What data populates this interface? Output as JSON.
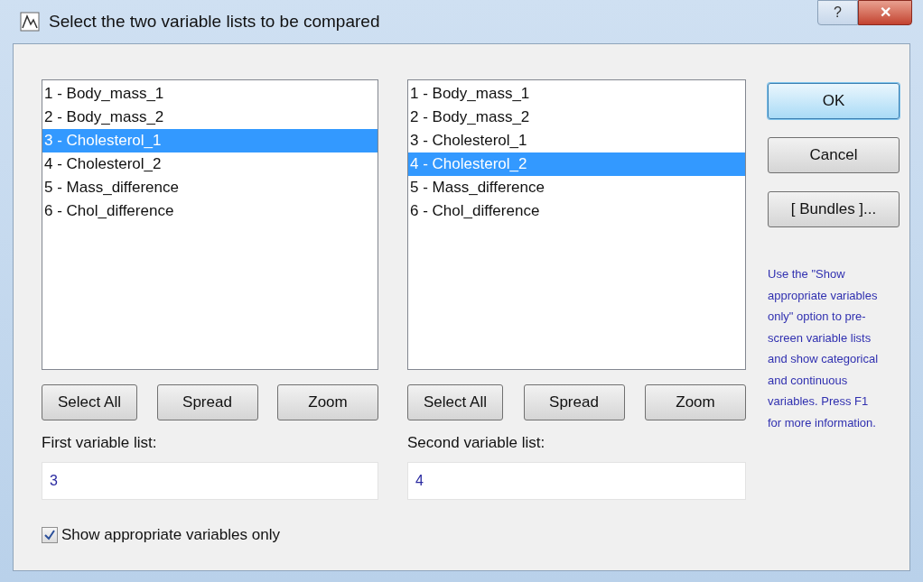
{
  "window": {
    "title": "Select the two variable lists to be compared",
    "help_button": "?",
    "close_button": "✕"
  },
  "panels": [
    {
      "items": [
        {
          "label": "1 - Body_mass_1",
          "selected": false
        },
        {
          "label": "2 - Body_mass_2",
          "selected": false
        },
        {
          "label": "3 - Cholesterol_1",
          "selected": true
        },
        {
          "label": "4 - Cholesterol_2",
          "selected": false
        },
        {
          "label": "5 - Mass_difference",
          "selected": false
        },
        {
          "label": "6 - Chol_difference",
          "selected": false
        }
      ],
      "buttons": [
        "Select All",
        "Spread",
        "Zoom"
      ],
      "field_label": "First variable list:",
      "field_value": "3"
    },
    {
      "items": [
        {
          "label": "1 - Body_mass_1",
          "selected": false
        },
        {
          "label": "2 - Body_mass_2",
          "selected": false
        },
        {
          "label": "3 - Cholesterol_1",
          "selected": false
        },
        {
          "label": "4 - Cholesterol_2",
          "selected": true
        },
        {
          "label": "5 - Mass_difference",
          "selected": false
        },
        {
          "label": "6 - Chol_difference",
          "selected": false
        }
      ],
      "buttons": [
        "Select All",
        "Spread",
        "Zoom"
      ],
      "field_label": "Second variable list:",
      "field_value": "4"
    }
  ],
  "side_buttons": [
    {
      "label": "OK",
      "default": true
    },
    {
      "label": "Cancel",
      "default": false
    },
    {
      "label": "[ Bundles ]...",
      "default": false
    }
  ],
  "help_text": "Use the \"Show appropriate variables only\" option to pre-screen variable lists and show categorical and continuous variables. Press F1 for more information.",
  "checkbox": {
    "label": "Show appropriate variables only",
    "checked": true
  }
}
